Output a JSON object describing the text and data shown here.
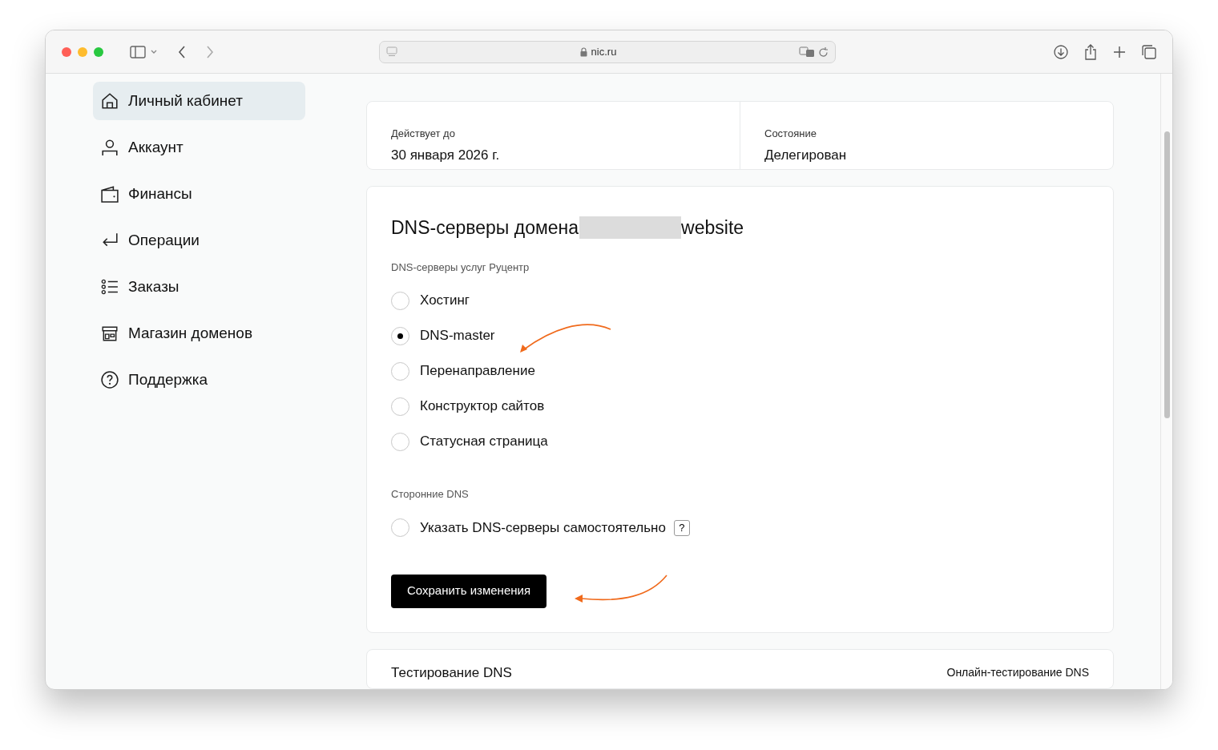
{
  "browser": {
    "address": "nic.ru"
  },
  "sidebar": {
    "items": [
      {
        "kind": "home",
        "label": "Личный кабинет",
        "selected": true
      },
      {
        "kind": "user",
        "label": "Аккаунт",
        "selected": false
      },
      {
        "kind": "wallet",
        "label": "Финансы",
        "selected": false
      },
      {
        "kind": "return",
        "label": "Операции",
        "selected": false
      },
      {
        "kind": "list",
        "label": "Заказы",
        "selected": false
      },
      {
        "kind": "shop",
        "label": "Магазин доменов",
        "selected": false
      },
      {
        "kind": "help",
        "label": "Поддержка",
        "selected": false
      }
    ]
  },
  "info": [
    {
      "label": "Действует до",
      "value": "30 января 2026 г."
    },
    {
      "label": "Состояние",
      "value": "Делегирован"
    }
  ],
  "dns": {
    "title_start": "DNS-серверы домена",
    "title_end": "website",
    "groups": [
      {
        "heading": "DNS-серверы услуг Руцентр",
        "options": [
          {
            "label": "Хостинг",
            "selected": false
          },
          {
            "label": "DNS-master",
            "selected": true
          },
          {
            "label": "Перенаправление",
            "selected": false
          },
          {
            "label": "Конструктор сайтов",
            "selected": false
          },
          {
            "label": "Статусная страница",
            "selected": false
          }
        ]
      },
      {
        "heading": "Сторонние DNS",
        "options": [
          {
            "label": "Указать DNS-серверы самостоятельно",
            "selected": false,
            "help": "?"
          }
        ]
      }
    ],
    "save_button": "Сохранить изменения"
  },
  "testing": {
    "title": "Тестирование DNS",
    "link": "Онлайн-тестирование DNS"
  }
}
